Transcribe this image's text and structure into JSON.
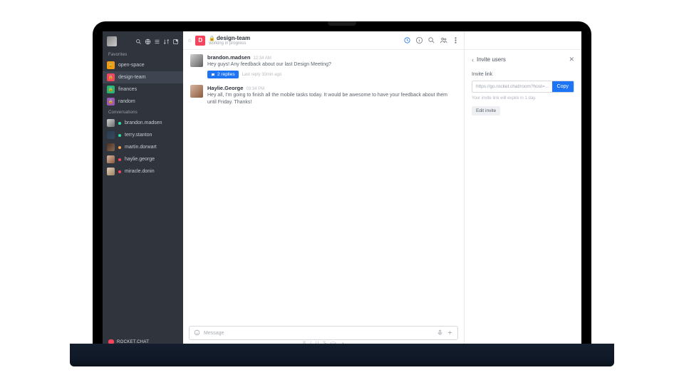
{
  "sidebar": {
    "sections": {
      "favorites_label": "Favorites",
      "conversations_label": "Conversations"
    },
    "favorites": [
      {
        "color": "#f39c12",
        "icon": "🔒",
        "name": "open-space"
      },
      {
        "color": "#f5455c",
        "icon": "🔒",
        "name": "design-team"
      },
      {
        "color": "#29b573",
        "icon": "🔒",
        "name": "finances"
      },
      {
        "color": "#9b59b6",
        "icon": "🔒",
        "name": "random"
      }
    ],
    "dms": [
      {
        "status": "#2de0a5",
        "name": "brandon.madsen",
        "av": "linear-gradient(135deg,#cfcfcf,#6d6d6d)"
      },
      {
        "status": "#2de0a5",
        "name": "terry.stanton",
        "av": "linear-gradient(135deg,#2c3e50,#34495e)"
      },
      {
        "status": "#ff9f43",
        "name": "martin.dorwart",
        "av": "linear-gradient(135deg,#503020,#836953)"
      },
      {
        "status": "#f5455c",
        "name": "haylie.george",
        "av": "linear-gradient(135deg,#d8b5a0,#8b5a3c)"
      },
      {
        "status": "#f5455c",
        "name": "miracle.donin",
        "av": "linear-gradient(135deg,#e0d0b8,#a08060)"
      }
    ],
    "logo": "ROCKET.CHAT"
  },
  "header": {
    "badge_letter": "D",
    "title": "design-team",
    "lock": "🔒",
    "subtitle": "working in progress"
  },
  "messages": [
    {
      "av": "linear-gradient(135deg,#d0d0d0,#606060)",
      "user": "brandon.madsen",
      "time": "12:34 AM",
      "text": "Hey guys! Any feedback about our last Design Meeting?",
      "replies": {
        "count": "2 replies",
        "meta": "Last reply 30min ago"
      }
    },
    {
      "av": "linear-gradient(135deg,#d8b5a0,#8b5a3c)",
      "user": "Haylie.George",
      "time": "03:34 PM",
      "text": "Hey all, I'm going to finish all the mobile tasks today. It would be awesome to have your feedback about them until Friday. Thanks!"
    }
  ],
  "composer": {
    "placeholder": "Message"
  },
  "panel": {
    "title": "Invite users",
    "link_label": "Invite link",
    "link_value": "https://go.rocket.chat/room?host=…",
    "copy": "Copy",
    "hint": "Your invite link will expire in 1 day.",
    "edit": "Edit invite"
  }
}
